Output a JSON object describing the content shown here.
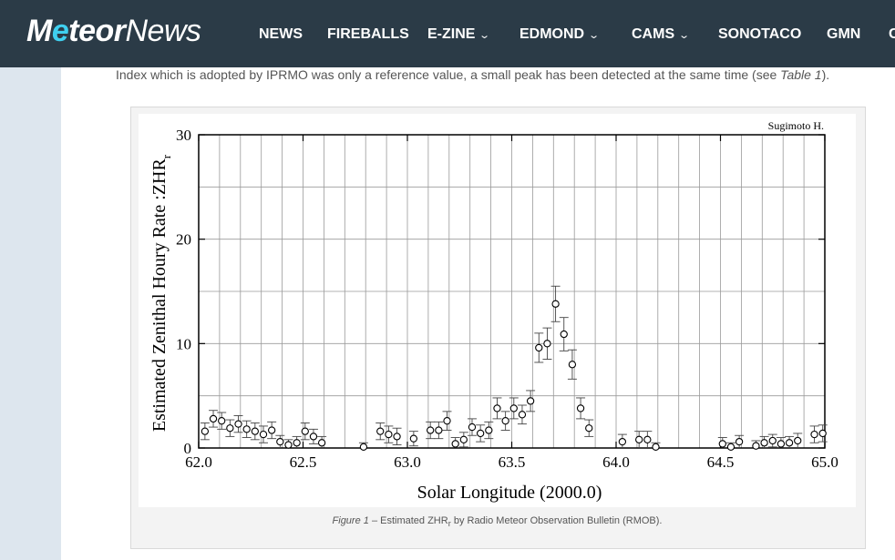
{
  "header": {
    "logo_part1": "M",
    "logo_part2": "e",
    "logo_part3": "teor",
    "logo_part4": "News",
    "nav": [
      {
        "label": "NEWS",
        "dropdown": false
      },
      {
        "label": "FIREBALLS",
        "dropdown": false
      },
      {
        "label": "E-ZINE",
        "dropdown": true
      },
      {
        "label": "EDMOND",
        "dropdown": true
      },
      {
        "label": "CAMS",
        "dropdown": true
      },
      {
        "label": "SONOTACO",
        "dropdown": false
      },
      {
        "label": "GMN",
        "dropdown": false
      },
      {
        "label": "C",
        "dropdown": false
      }
    ]
  },
  "article": {
    "intro_before": "Index which is adopted by IPRMO was only a reference value, a small peak has been detected at the same time (see ",
    "intro_ref": "Table 1",
    "intro_after": ").",
    "caption_fig": "Figure 1",
    "caption_mid": " – Estimated ZHR",
    "caption_sub": "r",
    "caption_end": " by Radio Meteor Observation Bulletin (RMOB)."
  },
  "colors": {
    "header_bg": "#2b3b47",
    "logo_accent": "#3fd0f0",
    "page_bg": "#e9eef1"
  },
  "chart_data": {
    "type": "scatter",
    "title": "",
    "annotation": "Sugimoto H.",
    "xlabel": "Solar Longitude (2000.0)",
    "ylabel_main": "Estimated Zenithal Houry Rate :ZHR",
    "ylabel_sub": "r",
    "xlim": [
      62.0,
      65.0
    ],
    "ylim": [
      0,
      30
    ],
    "x_ticks": [
      "62.0",
      "62.5",
      "63.0",
      "63.5",
      "64.0",
      "64.5",
      "65.0"
    ],
    "y_ticks": [
      "0",
      "10",
      "20",
      "30"
    ],
    "grid": true,
    "series": [
      {
        "marker": "open-circle",
        "error_bars": true,
        "x": [
          62.03,
          62.07,
          62.11,
          62.15,
          62.19,
          62.23,
          62.27,
          62.31,
          62.35,
          62.39,
          62.43,
          62.47,
          62.51,
          62.55,
          62.59,
          62.79,
          62.87,
          62.91,
          62.95,
          63.03,
          63.11,
          63.15,
          63.19,
          63.23,
          63.27,
          63.31,
          63.35,
          63.39,
          63.43,
          63.47,
          63.51,
          63.55,
          63.59,
          63.63,
          63.67,
          63.71,
          63.75,
          63.79,
          63.83,
          63.87,
          64.03,
          64.11,
          64.15,
          64.19,
          64.51,
          64.55,
          64.59,
          64.67,
          64.71,
          64.75,
          64.79,
          64.83,
          64.87,
          64.95,
          64.99
        ],
        "y": [
          1.6,
          2.8,
          2.6,
          1.9,
          2.3,
          1.8,
          1.6,
          1.3,
          1.7,
          0.6,
          0.3,
          0.5,
          1.6,
          1.1,
          0.5,
          0.1,
          1.6,
          1.3,
          1.1,
          0.9,
          1.7,
          1.7,
          2.6,
          0.4,
          0.8,
          2.0,
          1.4,
          1.7,
          3.8,
          2.6,
          3.8,
          3.2,
          4.5,
          9.6,
          10.0,
          13.8,
          10.9,
          8.0,
          3.8,
          1.9,
          0.6,
          0.8,
          0.8,
          0.1,
          0.4,
          0.1,
          0.6,
          0.2,
          0.5,
          0.7,
          0.4,
          0.5,
          0.7,
          1.3,
          1.4
        ],
        "err": [
          0.8,
          0.8,
          0.8,
          0.8,
          0.8,
          0.8,
          0.8,
          0.8,
          0.8,
          0.6,
          0.5,
          0.6,
          0.8,
          0.7,
          0.6,
          0.4,
          0.8,
          0.8,
          0.8,
          0.7,
          0.8,
          0.8,
          0.9,
          0.6,
          0.7,
          0.8,
          0.8,
          0.8,
          1.0,
          0.9,
          1.0,
          0.9,
          1.0,
          1.4,
          1.5,
          1.7,
          1.6,
          1.4,
          1.0,
          0.8,
          0.7,
          0.8,
          0.8,
          0.4,
          0.6,
          0.4,
          0.6,
          0.5,
          0.6,
          0.6,
          0.6,
          0.6,
          0.7,
          0.8,
          0.8
        ]
      }
    ]
  }
}
